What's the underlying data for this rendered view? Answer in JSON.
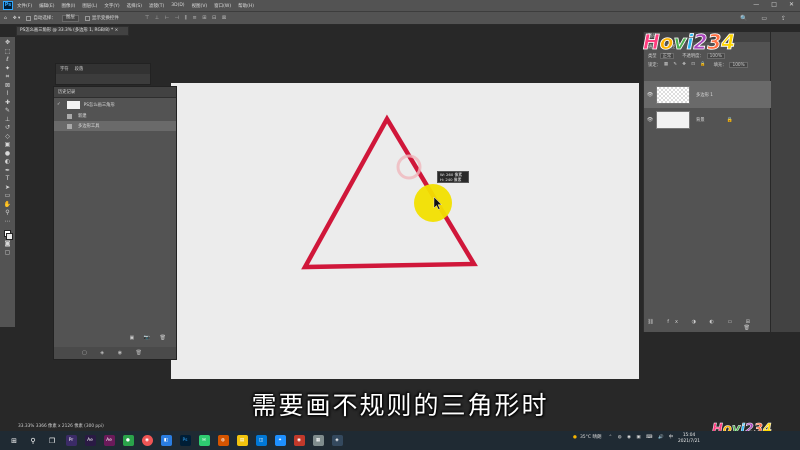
{
  "menubar": {
    "logo": "Ps",
    "items": [
      "文件(F)",
      "编辑(E)",
      "图像(I)",
      "图层(L)",
      "文字(Y)",
      "选择(S)",
      "滤镜(T)",
      "3D(D)",
      "视图(V)",
      "窗口(W)",
      "帮助(H)"
    ],
    "window_controls": [
      "—",
      "□",
      "✕"
    ]
  },
  "options": {
    "auto_select_label": "自动选择：",
    "auto_select_value": "图层",
    "show_transform_label": "显示变换控件",
    "align_glyphs": "⊤ ⊥ ⊢ ⊣ ⫼ ≡ ⊞ ⊟ ⊠"
  },
  "document": {
    "tab_title": "PS怎么画三角形 @ 33.3% (多边形 1, RGB/8) *",
    "close_glyph": "×"
  },
  "character_panel": {
    "tabs": [
      "字符",
      "段落"
    ]
  },
  "history_panel": {
    "title": "历史记录",
    "snapshot_label": "PS怎么画三角形",
    "steps": [
      {
        "label": "新建",
        "active": false
      },
      {
        "label": "多边形工具",
        "active": true
      }
    ]
  },
  "layers_panel": {
    "title": "图层",
    "tabs": [
      "通道",
      "路径"
    ],
    "kind_label": "类型",
    "mode_label": "正常",
    "opacity_label": "不透明度：",
    "opacity_value": "100%",
    "lock_label": "锁定：",
    "fill_label": "填充：",
    "fill_value": "100%",
    "layers": [
      {
        "name": "多边形 1",
        "selected": true
      },
      {
        "name": "背景",
        "selected": false,
        "locked": true
      }
    ]
  },
  "cursor_tip": {
    "width_line": "W: 260 像素",
    "height_line": "H: 240 像素"
  },
  "status": {
    "text": "33.33%    3366 像素 x 2126 像素 (300 ppi)"
  },
  "subtitle": {
    "text": "需要画不规则的三角形时"
  },
  "watermark": {
    "text": "Hovi234",
    "colors": [
      "#ff3d7f",
      "#ffb300",
      "#4caf50",
      "#29b6f6",
      "#ab47bc",
      "#ff7043",
      "#ffd600"
    ]
  },
  "taskbar": {
    "weather": "35°C  晴朗",
    "clock_time": "15:04",
    "clock_date": "2021/7/21",
    "lang": "中"
  },
  "colors": {
    "triangle_stroke": "#d0173a",
    "canvas_bg": "#ececec",
    "cursor_highlight": "#f2e000"
  }
}
